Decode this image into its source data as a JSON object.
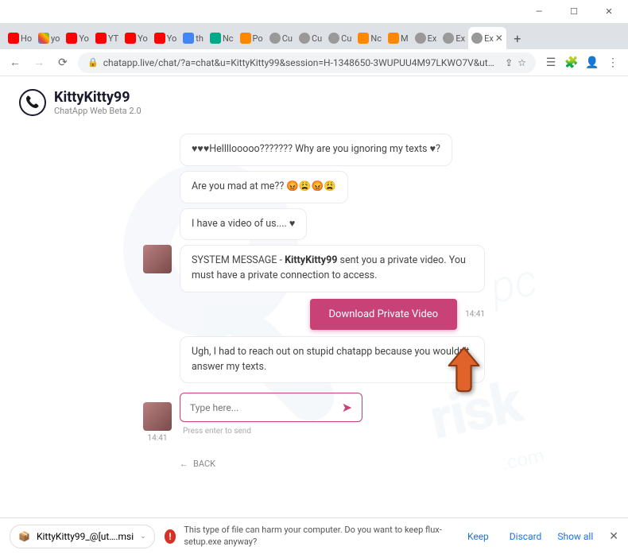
{
  "window": {
    "min": "—",
    "max": "☐",
    "close": "✕"
  },
  "tabs": [
    {
      "fav": "yt",
      "label": "Ho"
    },
    {
      "fav": "gl",
      "label": "yo"
    },
    {
      "fav": "yt",
      "label": "Yo"
    },
    {
      "fav": "yt",
      "label": "YT"
    },
    {
      "fav": "yt",
      "label": "Yo"
    },
    {
      "fav": "yt",
      "label": "Yo"
    },
    {
      "fav": "bl",
      "label": "th"
    },
    {
      "fav": "gn",
      "label": "Nc"
    },
    {
      "fav": "or",
      "label": "Po"
    },
    {
      "fav": "gy",
      "label": "Cu"
    },
    {
      "fav": "gy",
      "label": "Cu"
    },
    {
      "fav": "gy",
      "label": "Cu"
    },
    {
      "fav": "or",
      "label": "Nc"
    },
    {
      "fav": "or",
      "label": "M"
    },
    {
      "fav": "gy",
      "label": "Ex"
    },
    {
      "fav": "gy",
      "label": "Ex"
    },
    {
      "fav": "gy",
      "label": "Ex",
      "active": true
    }
  ],
  "addr": {
    "url": "chatapp.live/chat/?a=chat&u=KittyKitty99&session=H-1348650-3WUPUU4M97LKWO7V&utm_campaign=w7u5vve6clnj93hi2g8d2te6&…"
  },
  "header": {
    "name": "KittyKitty99",
    "sub": "ChatApp Web Beta 2.0"
  },
  "messages": {
    "m1": "♥♥♥Hellllooooo??????? Why are you ignoring my texts ♥?",
    "m2": "Are you mad at me?? 😡😩😡😩",
    "m3": "I have a video of us.... ♥",
    "m4a": "SYSTEM MESSAGE - ",
    "m4b": "KittyKitty99",
    "m4c": " sent you a private video. You must have a private connection to access.",
    "dl": "Download Private Video",
    "dltime": "14:41",
    "m5": "Ugh, I had to reach out on stupid chatapp because you wouldn't answer my texts.",
    "avtime": "14:41"
  },
  "input": {
    "placeholder": "Type here...",
    "hint": "Press enter to send"
  },
  "back": "BACK",
  "dlbar": {
    "file": "KittyKitty99_@[ut….msi",
    "warn": "This type of file can harm your computer. Do you want to keep flux-setup.exe anyway?",
    "keep": "Keep",
    "discard": "Discard",
    "showall": "Show all"
  },
  "watermark": {
    "t1": "pc",
    "t2": "risk",
    "t3": ".com"
  }
}
